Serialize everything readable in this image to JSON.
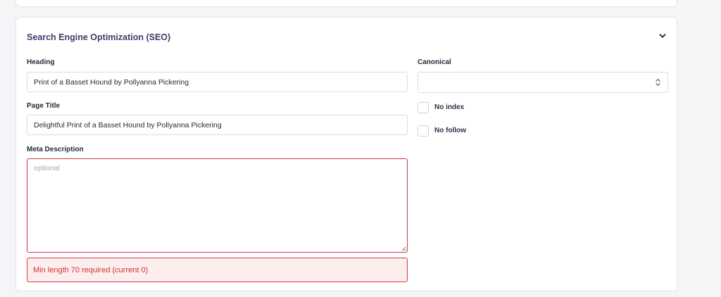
{
  "section": {
    "title": "Search Engine Optimization (SEO)",
    "collapse_icon": "chevron-down-icon"
  },
  "heading": {
    "label": "Heading",
    "value": "Print of a Basset Hound by Pollyanna Pickering"
  },
  "page_title": {
    "label": "Page Title",
    "value": "Delightful Print of a Basset Hound by Pollyanna Pickering"
  },
  "meta_description": {
    "label": "Meta Description",
    "placeholder": "optional",
    "value": "",
    "error": "Min length 70 required (current 0)"
  },
  "canonical": {
    "label": "Canonical",
    "selected": ""
  },
  "checkboxes": [
    {
      "label": "No index",
      "checked": false
    },
    {
      "label": "No follow",
      "checked": false
    }
  ],
  "colors": {
    "title": "#3b3f67",
    "error_text": "#d02f35",
    "error_bg": "#fdeeee",
    "error_border": "#c8353b"
  }
}
